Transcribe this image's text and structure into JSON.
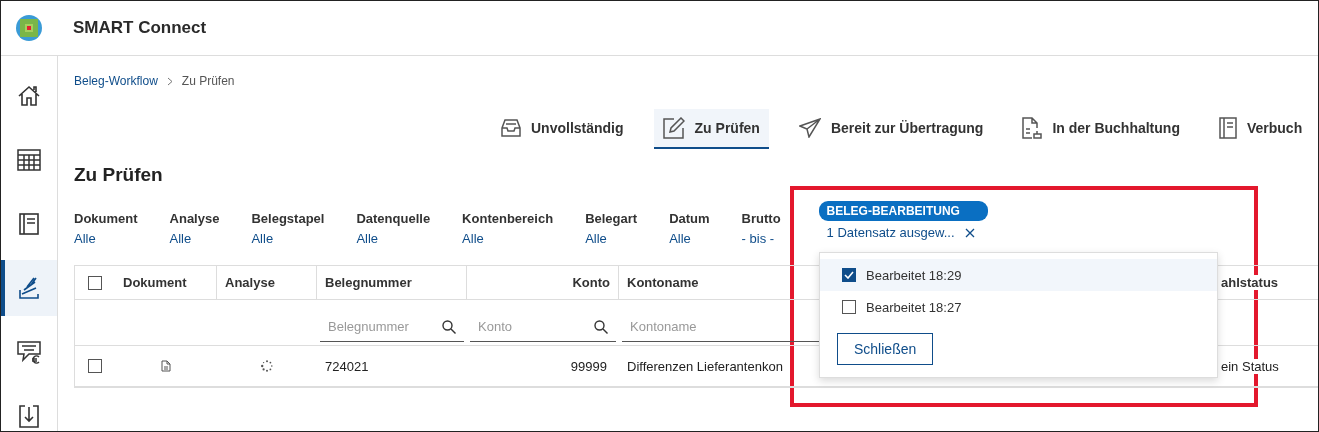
{
  "app": {
    "title": "SMART Connect"
  },
  "sidebar": {
    "items": [
      {
        "selected": false
      },
      {
        "selected": false
      },
      {
        "selected": false
      },
      {
        "selected": true
      },
      {
        "selected": false
      },
      {
        "selected": false
      }
    ]
  },
  "breadcrumb": [
    {
      "label": "Beleg-Workflow",
      "kind": "link"
    },
    {
      "label": "Zu Prüfen",
      "kind": "current"
    }
  ],
  "tabs": [
    {
      "label": "Unvollständig",
      "selected": false
    },
    {
      "label": "Zu Prüfen",
      "selected": true
    },
    {
      "label": "Bereit zur Übertragung",
      "selected": false
    },
    {
      "label": "In der Buchhaltung",
      "selected": false
    },
    {
      "label": "Verbuch",
      "selected": false
    }
  ],
  "heading": "Zu Prüfen",
  "filters": [
    {
      "label": "Dokument",
      "value": "Alle"
    },
    {
      "label": "Analyse",
      "value": "Alle"
    },
    {
      "label": "Belegstapel",
      "value": "Alle"
    },
    {
      "label": "Datenquelle",
      "value": "Alle"
    },
    {
      "label": "Kontenbereich",
      "value": "Alle"
    },
    {
      "label": "Belegart",
      "value": "Alle"
    },
    {
      "label": "Datum",
      "value": "Alle"
    },
    {
      "label": "Brutto",
      "value": "- bis -"
    }
  ],
  "active_filter": {
    "label": "BELEG-BEARBEITUNG",
    "value": "1 Datensatz ausgew...",
    "options": [
      {
        "label": "Bearbeitet 18:29",
        "checked": true,
        "highlighted": true
      },
      {
        "label": "Bearbeitet 18:27",
        "checked": false,
        "highlighted": false
      }
    ],
    "close_button": "Schließen"
  },
  "table": {
    "header_checked": false,
    "columns": [
      {
        "label": "Dokument"
      },
      {
        "label": "Analyse"
      },
      {
        "label": "Belegnummer",
        "placeholder": "Belegnummer"
      },
      {
        "label": "Konto",
        "placeholder": "Konto"
      },
      {
        "label": "Kontoname",
        "placeholder": "Kontoname"
      },
      {
        "label": "ahlstatus"
      }
    ],
    "rows": [
      {
        "checked": false,
        "belegnummer": "724021",
        "konto": "99999",
        "kontoname": "Differenzen Lieferantenkon",
        "status": "ein Status"
      }
    ]
  }
}
